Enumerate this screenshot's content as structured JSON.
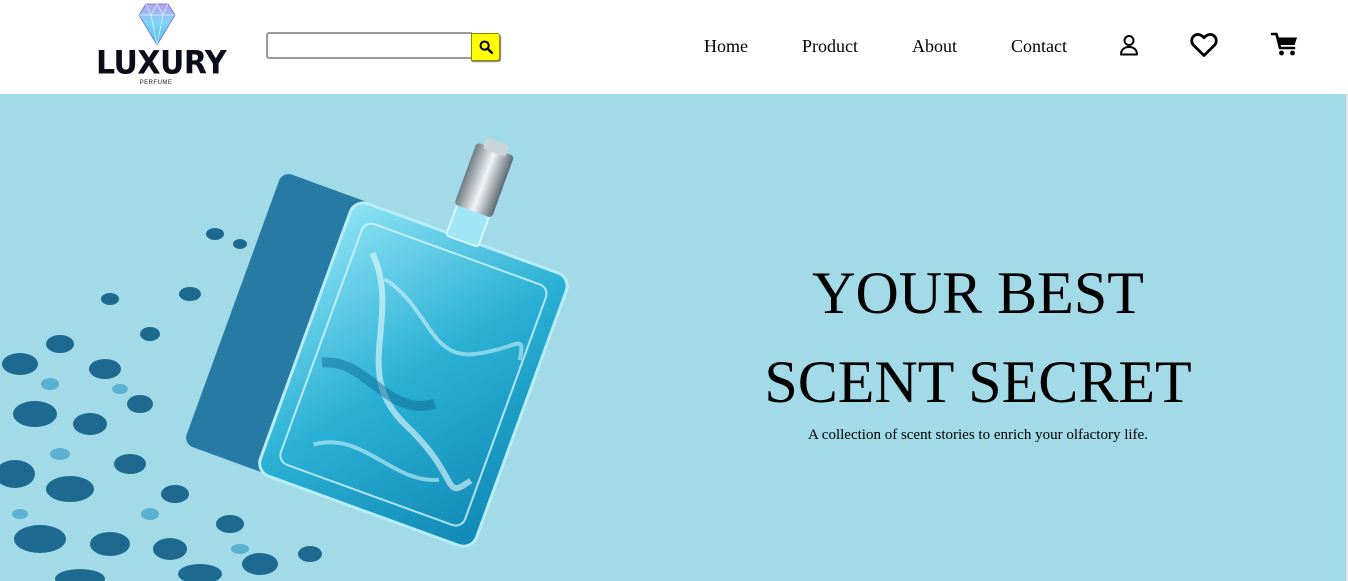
{
  "brand": {
    "name": "LUXURY",
    "tagline": "PERFUME",
    "gem_colors": [
      "#b8a3f0",
      "#7fd6f5",
      "#4fb8e8"
    ]
  },
  "search": {
    "placeholder": "",
    "value": "",
    "button_icon": "search-icon",
    "button_color": "#ffff00"
  },
  "nav": {
    "items": [
      {
        "label": "Home"
      },
      {
        "label": "Product"
      },
      {
        "label": "About"
      },
      {
        "label": "Contact"
      }
    ],
    "icons": [
      "user-icon",
      "heart-icon",
      "cart-icon"
    ]
  },
  "hero": {
    "title_line1": "YOUR BEST",
    "title_line2": "SCENT SECRET",
    "subtitle": "A collection of scent stories to enrich your olfactory life.",
    "background_color": "#a2dae8",
    "image": "perfume-bottle-image"
  }
}
